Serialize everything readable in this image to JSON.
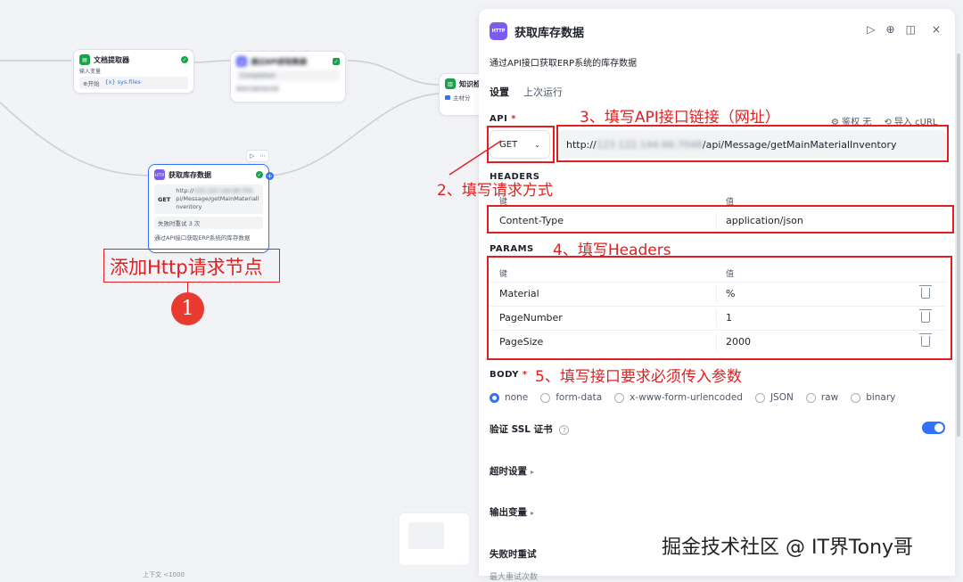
{
  "canvas": {
    "node_doc": {
      "title": "文档提取器",
      "var_label": "输入变量",
      "var_start": "⊕开始",
      "var_value": "{x} sys.files"
    },
    "node_blur": {
      "title": "通过API获取数据",
      "line1": "Completion",
      "line2": "相关内容的知识库"
    },
    "node_kb": {
      "title": "知识检",
      "line1": "主材分"
    },
    "node_http": {
      "title": "获取库存数据",
      "method": "GET",
      "url_line1": "http://",
      "url_line2": "pi/Message/getMainMateriall",
      "url_line3": "nventory",
      "retry": "失败时重试 3 次",
      "desc": "通过API接口获取ERP系统的库存数据"
    },
    "node_toolbar": {
      "play": "▷",
      "more": "⋯"
    },
    "bottom_left_text": "上下文 <1000"
  },
  "annotations": {
    "step1_label": "添加Http请求节点",
    "step1_num": "1",
    "step2": "2、填写请求方式",
    "step3": "3、填写API接口链接（网址）",
    "step4": "4、填写Headers",
    "step5": "5、填写接口要求必须传入参数"
  },
  "panel": {
    "icon": "HTTP",
    "title": "获取库存数据",
    "description": "通过API接口获取ERP系统的库存数据",
    "tools": {
      "run": "▷",
      "locate": "⊕",
      "layout": "◫",
      "close": "×"
    },
    "tabs": [
      {
        "label": "设置",
        "active": true
      },
      {
        "label": "上次运行",
        "active": false
      }
    ],
    "api": {
      "label": "API",
      "required": "*",
      "auth": "鉴权 无",
      "import_curl": "导入 cURL",
      "method": "GET",
      "url_prefix": "http://",
      "url_blurred": "123.122.144.66:7048",
      "url_suffix": "/api/Message/getMainMaterialInventory"
    },
    "headers": {
      "label": "HEADERS",
      "key_col": "键",
      "value_col": "值",
      "rows": [
        {
          "key": "Content-Type",
          "value": "application/json"
        }
      ]
    },
    "params": {
      "label": "PARAMS",
      "key_col": "键",
      "value_col": "值",
      "rows": [
        {
          "key": "Material",
          "value": "%"
        },
        {
          "key": "PageNumber",
          "value": "1"
        },
        {
          "key": "PageSize",
          "value": "2000"
        }
      ]
    },
    "body": {
      "label": "BODY",
      "required": "*",
      "options": [
        "none",
        "form-data",
        "x-www-form-urlencoded",
        "JSON",
        "raw",
        "binary"
      ],
      "selected": "none"
    },
    "ssl": {
      "label": "验证 SSL 证书",
      "enabled": true
    },
    "timeout": {
      "label": "超时设置"
    },
    "output": {
      "label": "输出变量"
    },
    "retry": {
      "label": "失败时重试",
      "max_label": "最大重试次数"
    }
  },
  "watermark": "掘金技术社区 @ IT界Tony哥",
  "colors": {
    "accent": "#3370ff",
    "annotation": "#e02020",
    "http_icon": "#7c5cf0",
    "success": "#16a34a"
  }
}
